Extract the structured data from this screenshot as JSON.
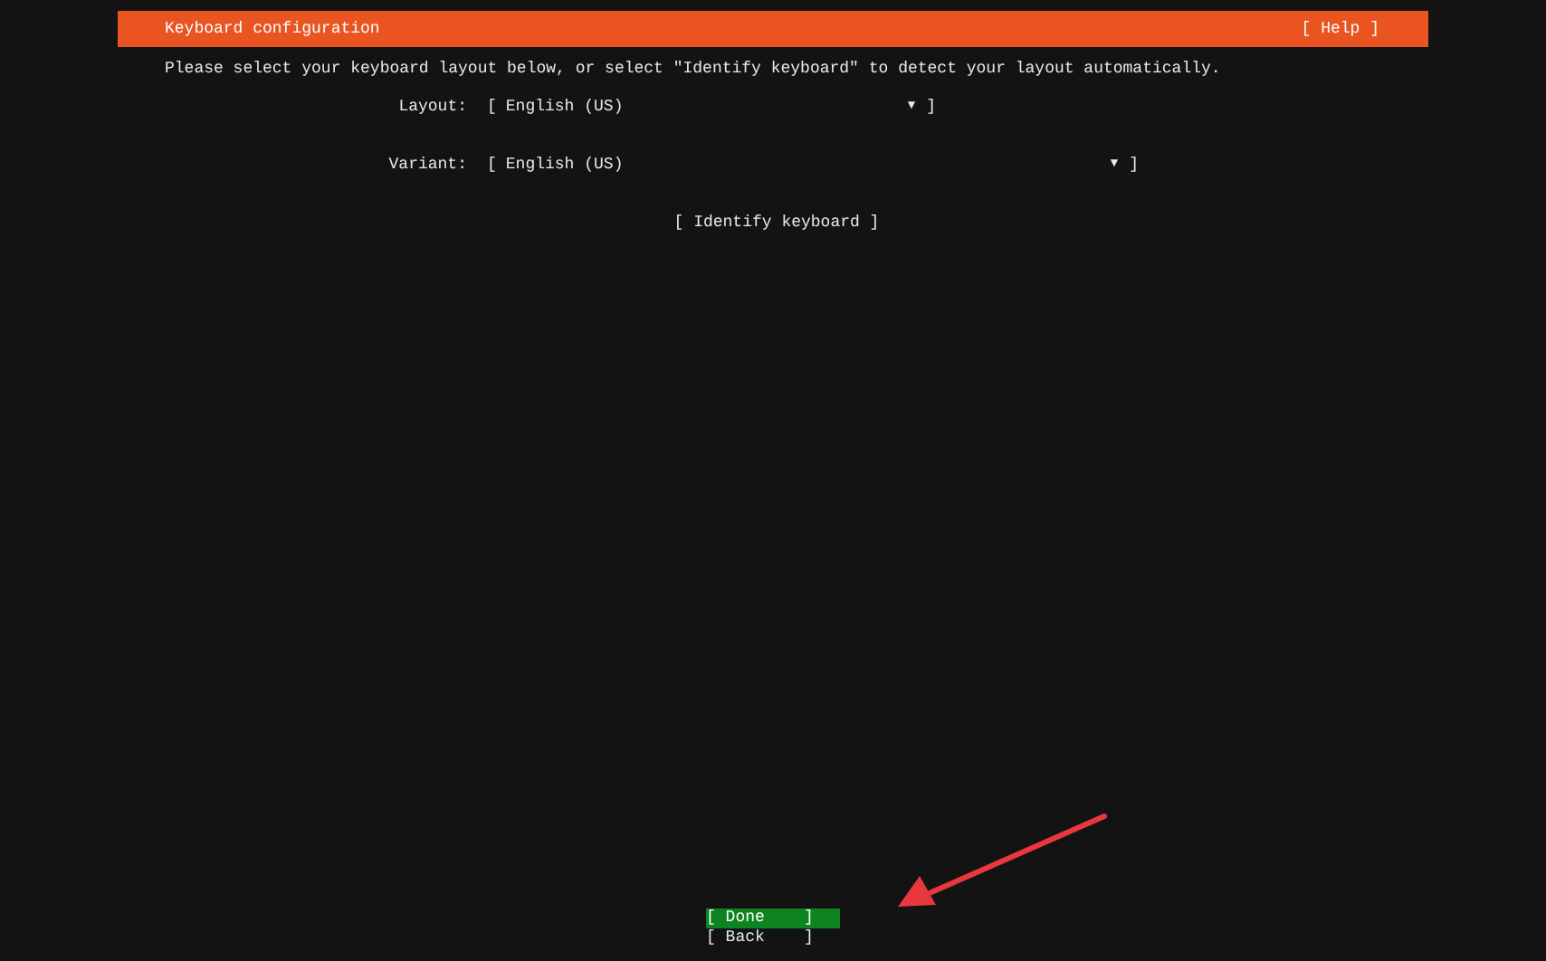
{
  "header": {
    "title": "Keyboard configuration",
    "help": "[ Help ]"
  },
  "instructions": "Please select your keyboard layout below, or select \"Identify keyboard\" to detect your layout automatically.",
  "dropdowns": [
    {
      "label": "Layout:",
      "open_bracket": "[",
      "value": "English (US)",
      "arrow": "▼",
      "close_bracket": "]"
    },
    {
      "label": "Variant:",
      "open_bracket": "[",
      "value": "English (US)",
      "arrow": "▼",
      "close_bracket": "]"
    }
  ],
  "identify_button": "[ Identify keyboard ]",
  "buttons": [
    {
      "text": "[ Done    ]",
      "selected": true
    },
    {
      "text": "[ Back    ]",
      "selected": false
    }
  ]
}
